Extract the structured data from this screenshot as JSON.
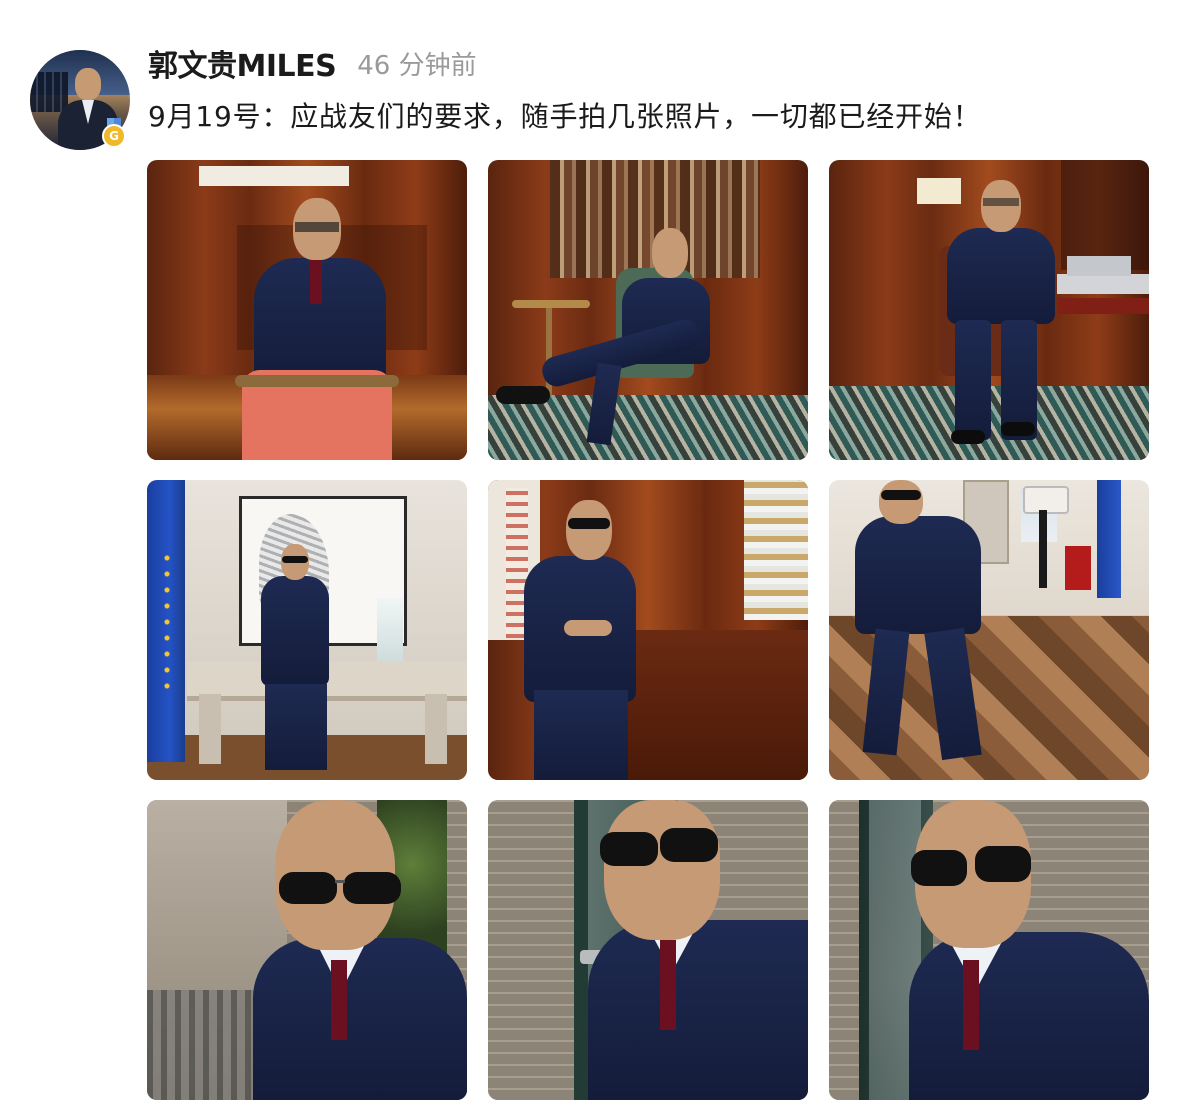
{
  "post": {
    "username": "郭文贵MILES",
    "timestamp": "46 分钟前",
    "text": "9月19号：应战友们的要求，随手拍几张照片，一切都已经开始！",
    "avatar_badge": "G"
  },
  "photos": [
    {
      "icon": "photo-wood-office-chair"
    },
    {
      "icon": "photo-library-armchair"
    },
    {
      "icon": "photo-seated-carpet"
    },
    {
      "icon": "photo-desk-flag"
    },
    {
      "icon": "photo-bar-sunglasses"
    },
    {
      "icon": "photo-seated-parquet"
    },
    {
      "icon": "photo-selfie-terrace"
    },
    {
      "icon": "photo-selfie-brick"
    },
    {
      "icon": "photo-selfie-door"
    }
  ],
  "colors": {
    "text": "#1b1b1b",
    "muted": "#9a9a9a",
    "badge": "#f0b92b"
  }
}
